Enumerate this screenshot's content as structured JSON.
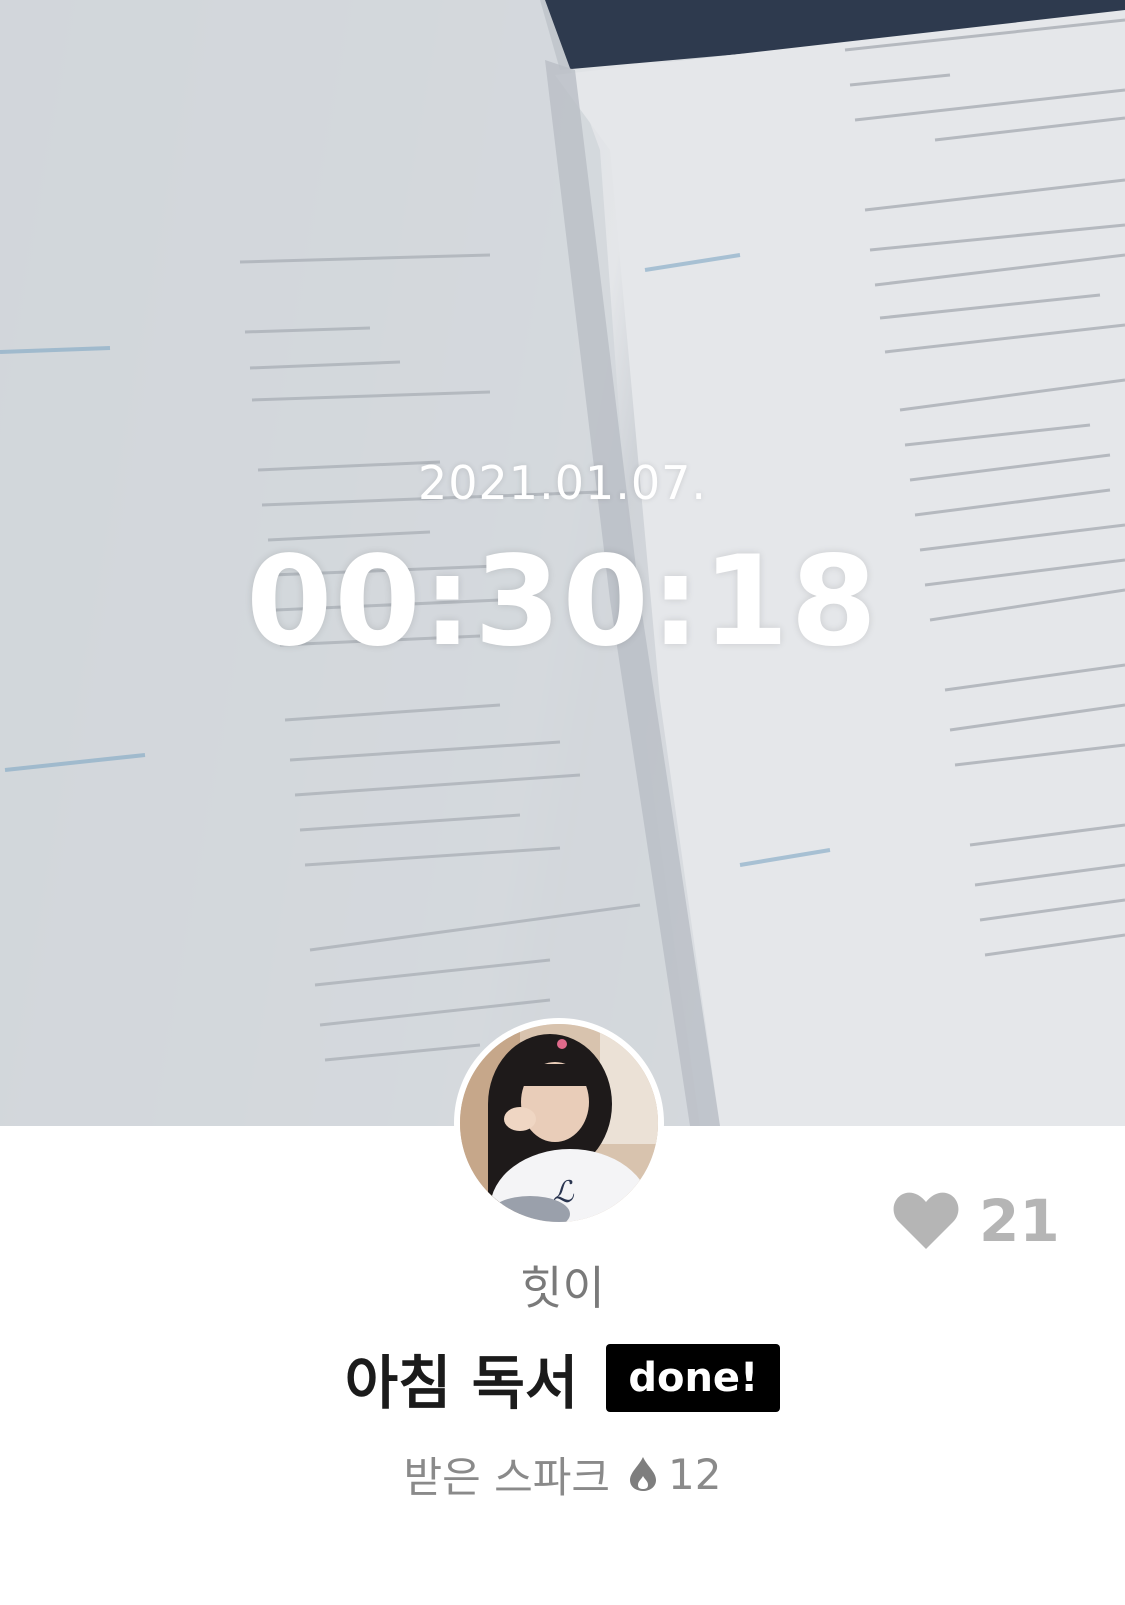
{
  "post": {
    "date": "2021.01.07.",
    "timer": "00:30:18",
    "username": "힛이",
    "title": "아침 독서",
    "status_badge": "done!",
    "likes": "21",
    "spark_label": "받은 스파크",
    "spark_count": "12"
  },
  "icons": {
    "like": "heart-icon",
    "spark": "fire-drop-icon"
  },
  "colors": {
    "badge_bg": "#000000",
    "like_gray": "#b5b5b5",
    "secondary_text": "#8a8a8a"
  }
}
